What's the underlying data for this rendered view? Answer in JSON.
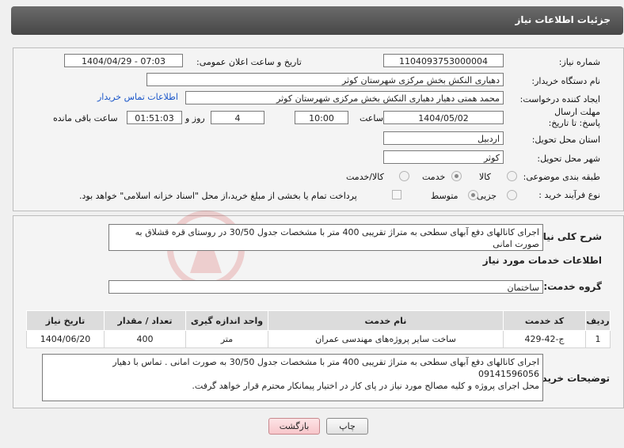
{
  "header": {
    "title": "جزئیات اطلاعات نیاز"
  },
  "form": {
    "need_number_label": "شماره نیاز:",
    "need_number": "1104093753000004",
    "announce_label": "تاریخ و ساعت اعلان عمومی:",
    "announce_value": "1404/04/29 - 07:03",
    "buyer_label": "نام دستگاه خریدار:",
    "buyer_value": "دهیاری النکش بخش مرکزی شهرستان کوثر",
    "creator_label": "ایجاد کننده درخواست:",
    "creator_value": "محمد همتی دهیار دهیاری النکش بخش مرکزی شهرستان کوثر",
    "contact_link": "اطلاعات تماس خریدار",
    "deadline_label": "مهلت ارسال پاسخ: تا تاریخ:",
    "deadline_date": "1404/05/02",
    "time_label": "ساعت",
    "deadline_time": "10:00",
    "days_value": "4",
    "days_label": "روز و",
    "remaining_time": "01:51:03",
    "remaining_label": "ساعت باقی مانده",
    "province_label": "استان محل تحویل:",
    "province_value": "اردبیل",
    "city_label": "شهر محل تحویل:",
    "city_value": "کوثر",
    "category_label": "طبقه بندی موضوعی:",
    "category_options": [
      "کالا",
      "خدمت",
      "کالا/خدمت"
    ],
    "purchase_type_label": "نوع فرآیند خرید :",
    "purchase_type_options": [
      "جزیی",
      "متوسط"
    ],
    "payment_note": "پرداخت تمام یا بخشی از مبلغ خرید،از محل \"اسناد خزانه اسلامی\" خواهد بود."
  },
  "description": {
    "label": "شرح کلی نیاز:",
    "text": "اجرای کانالهای دفع آبهای سطحی به متراژ تقریبی 400 متر با مشخصات جدول 30/50 در روستای قره قشلاق به صورت امانی"
  },
  "services": {
    "section_title": "اطلاعات خدمات مورد نیاز",
    "group_label": "گروه خدمت:",
    "group_value": "ساختمان",
    "columns": [
      "ردیف",
      "کد خدمت",
      "نام خدمت",
      "واحد اندازه گیری",
      "تعداد / مقدار",
      "تاریخ نیاز"
    ],
    "rows": [
      {
        "row": "1",
        "code": "ج-42-429",
        "name": "ساخت سایر پروژه‌های مهندسی عمران",
        "unit": "متر",
        "qty": "400",
        "date": "1404/06/20"
      }
    ]
  },
  "buyer_notes": {
    "label": "توضیحات خریدار:",
    "line1": "اجرای کانالهای دفع آبهای سطحی به متراژ تقریبی 400 متر با مشخصات جدول 30/50 به صورت امانی . تماس با دهیار",
    "line2": "09141596056",
    "line3": "محل اجرای پروژه و کلیه مصالح مورد نیاز در پای کار در اختیار پیمانکار محترم قرار خواهد گرفت."
  },
  "buttons": {
    "print": "چاپ",
    "back": "بازگشت"
  },
  "colors": {
    "header_bg": "#555555",
    "link": "#1a56c9",
    "back_button": "#f7c6ca"
  }
}
